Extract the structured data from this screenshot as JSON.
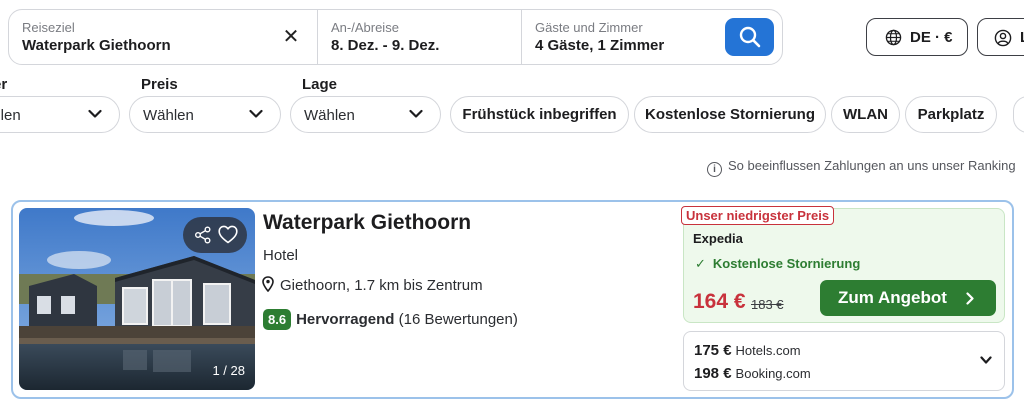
{
  "search": {
    "destination_label": "Reiseziel",
    "destination_value": "Waterpark Giethoorn",
    "clear_icon": "close-icon",
    "dates_label": "An-/Abreise",
    "dates_value": "8. Dez. - 9. Dez.",
    "guests_label": "Gäste und Zimmer",
    "guests_value": "4 Gäste, 1 Zimmer",
    "search_icon": "search-icon"
  },
  "header": {
    "language_currency": "DE · €",
    "user_label": "L"
  },
  "filters": {
    "dropdowns": [
      {
        "label": "ter",
        "value": "ählen"
      },
      {
        "label": "Preis",
        "value": "Wählen"
      },
      {
        "label": "Lage",
        "value": "Wählen"
      }
    ],
    "chips": [
      "Frühstück inbegriffen",
      "Kostenlose Stornierung",
      "WLAN",
      "Parkplatz"
    ]
  },
  "ranking_info": "So beeinflussen Zahlungen an uns unser Ranking",
  "hotel": {
    "name": "Waterpark Giethoorn",
    "type": "Hotel",
    "location": "Giethoorn, 1.7 km bis Zentrum",
    "rating_score": "8.6",
    "rating_text": "Hervorragend",
    "rating_count": "(16 Bewertungen)",
    "photo_counter": "1 / 28"
  },
  "deal": {
    "badge": "Unser niedrigster Preis",
    "provider": "Expedia",
    "cancellation": "Kostenlose Stornierung",
    "price": "164 €",
    "old_price": "183 €",
    "cta": "Zum Angebot"
  },
  "other_offers": [
    {
      "price": "175 €",
      "provider": "Hotels.com"
    },
    {
      "price": "198 €",
      "provider": "Booking.com"
    }
  ],
  "colors": {
    "accent_blue": "#2474d6",
    "deal_green": "#2d7d32",
    "price_red": "#c8323c",
    "deal_bg": "#eef9ec",
    "card_border": "#9cc2ea"
  }
}
